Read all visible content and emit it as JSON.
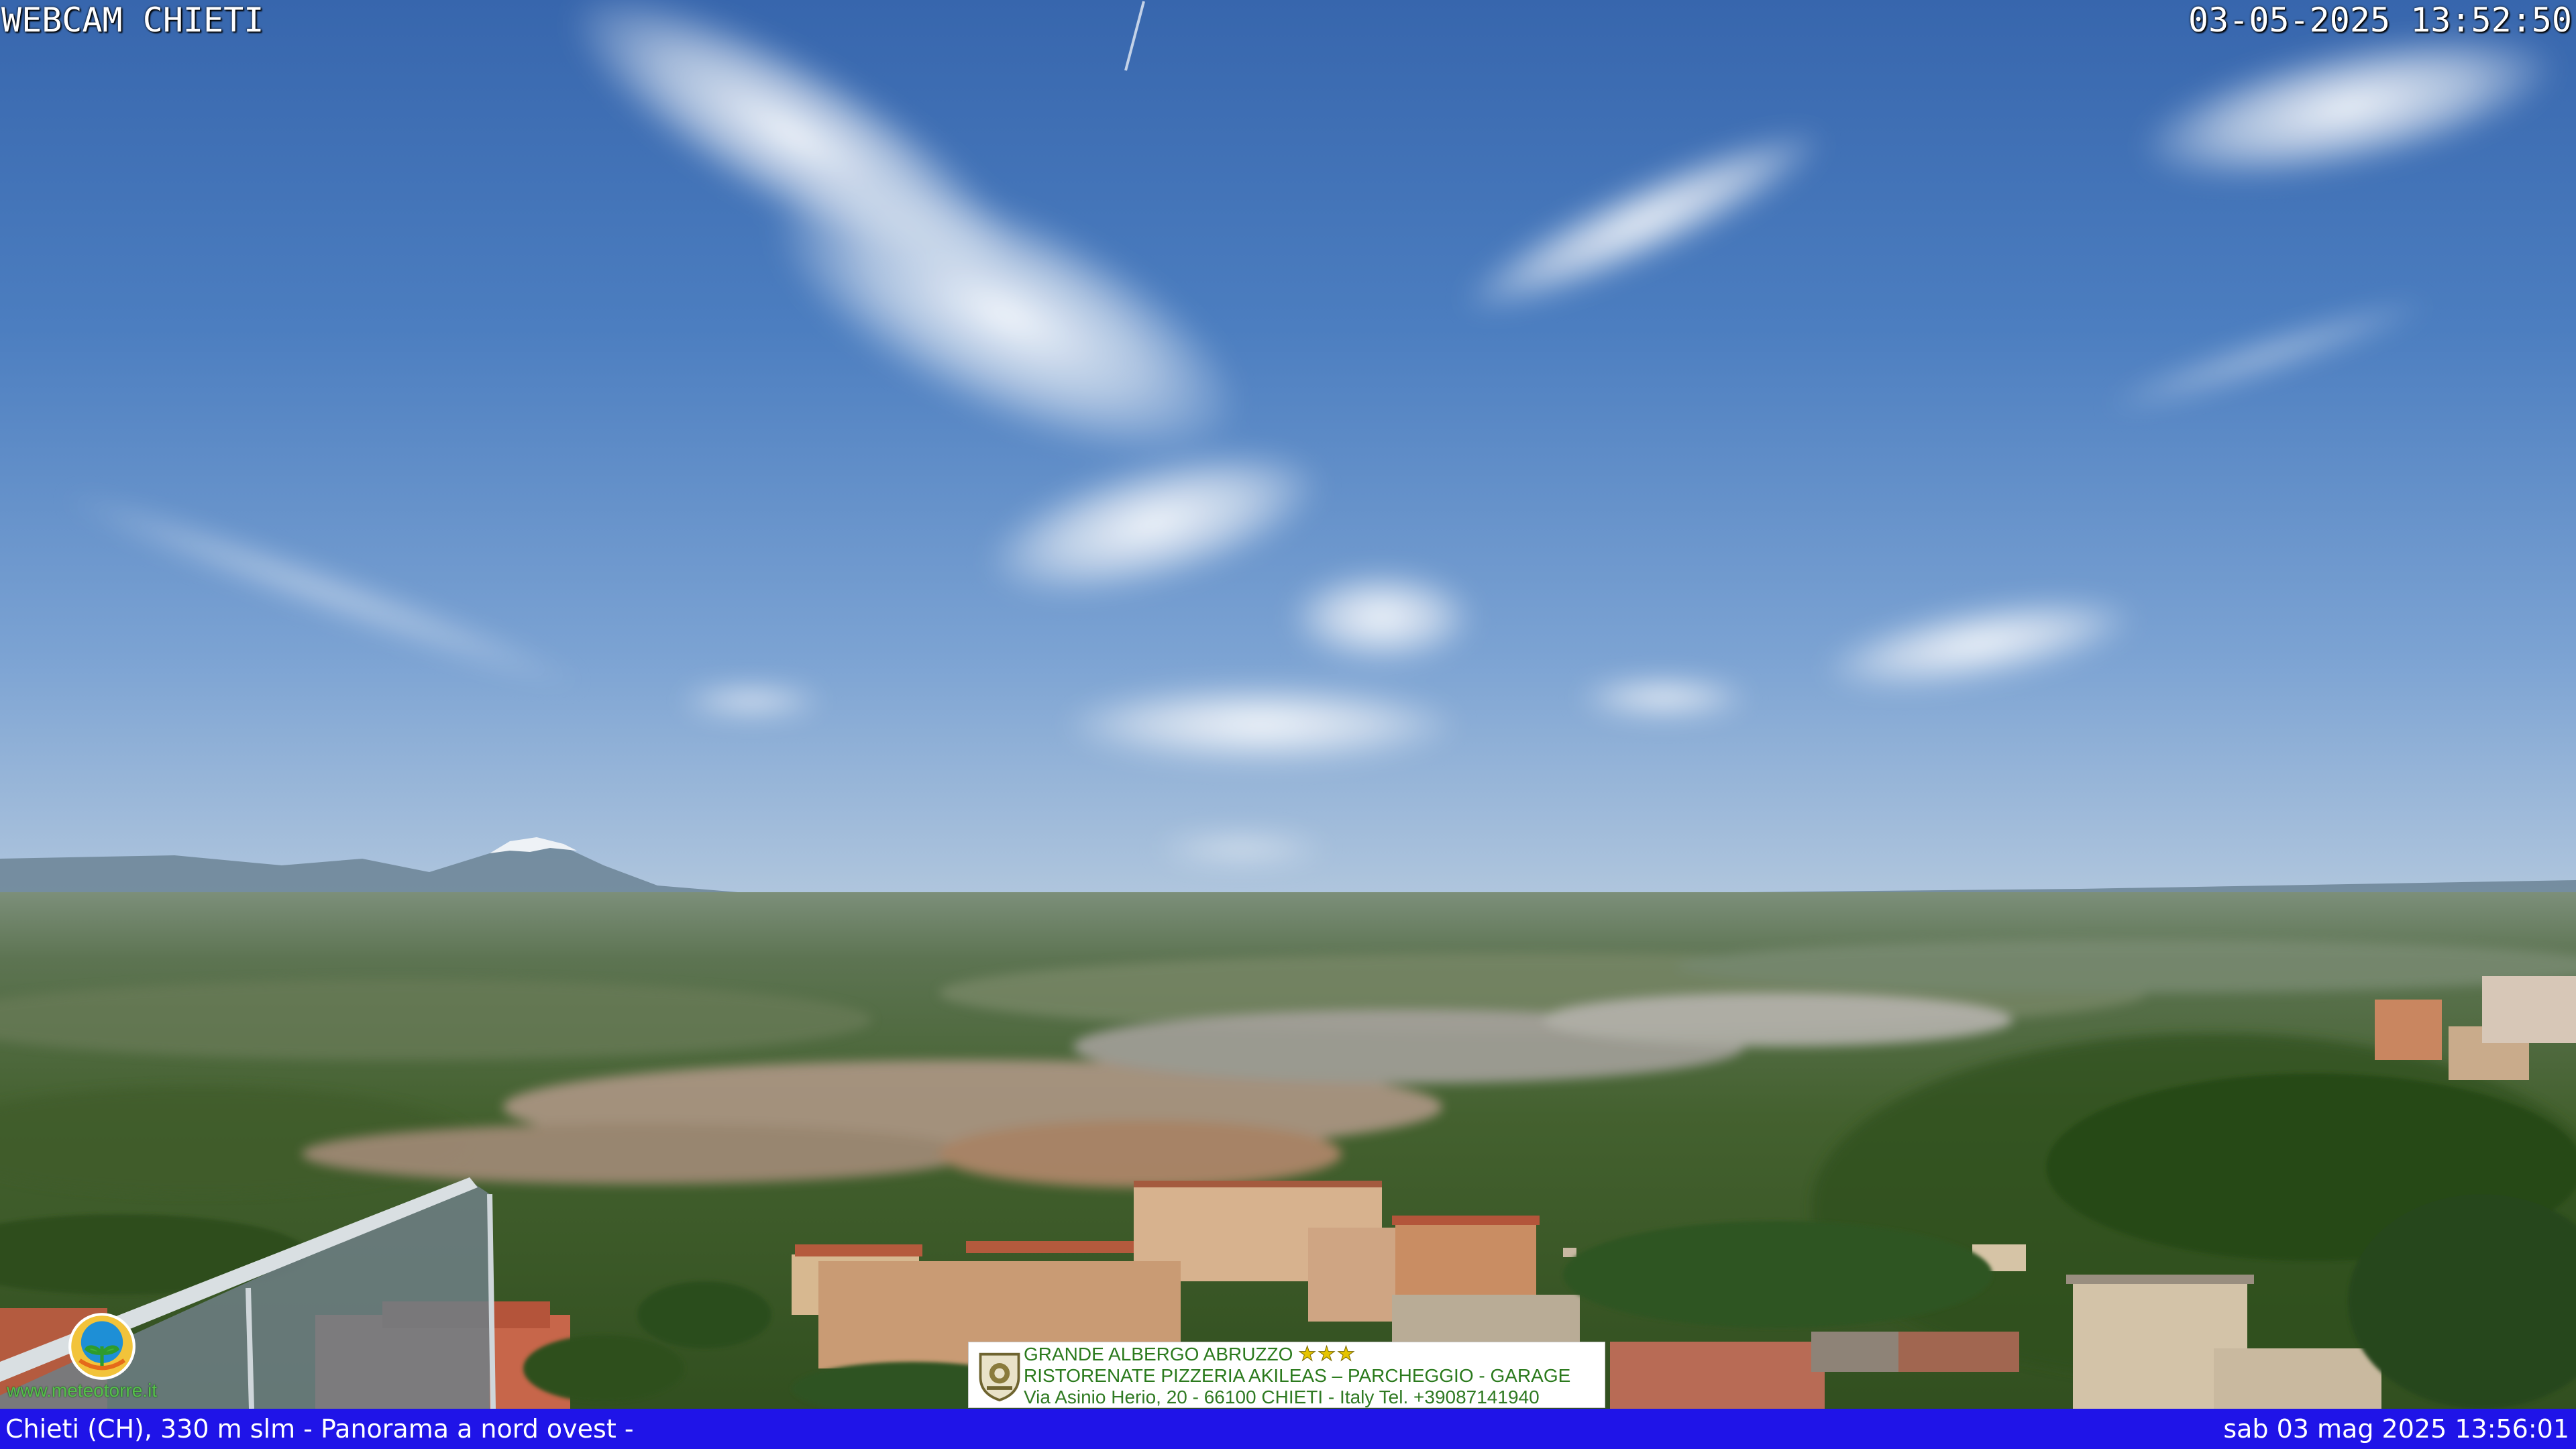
{
  "overlay": {
    "title": "WEBCAM CHIETI",
    "timestamp": "03-05-2025 13:52:50"
  },
  "footer": {
    "location": "Chieti (CH), 330 m slm - Panorama a nord ovest -",
    "datetime": "sab 03 mag 2025 13:56:01"
  },
  "advertisement": {
    "line1": "GRANDE ALBERGO ABRUZZO",
    "stars": "★★★",
    "line2": "RISTORENATE PIZZERIA AKILEAS – PARCHEGGIO - GARAGE",
    "line3": "Via Asinio Herio, 20 - 66100 CHIETI - Italy Tel. +39087141940"
  },
  "watermark": {
    "text": "www.meteotorre.it",
    "icon": "weather-logo-icon"
  },
  "colors": {
    "footer_bar": "#1f14e8",
    "sky": "#3f6fb3",
    "ad_text": "#2b7a1d"
  }
}
